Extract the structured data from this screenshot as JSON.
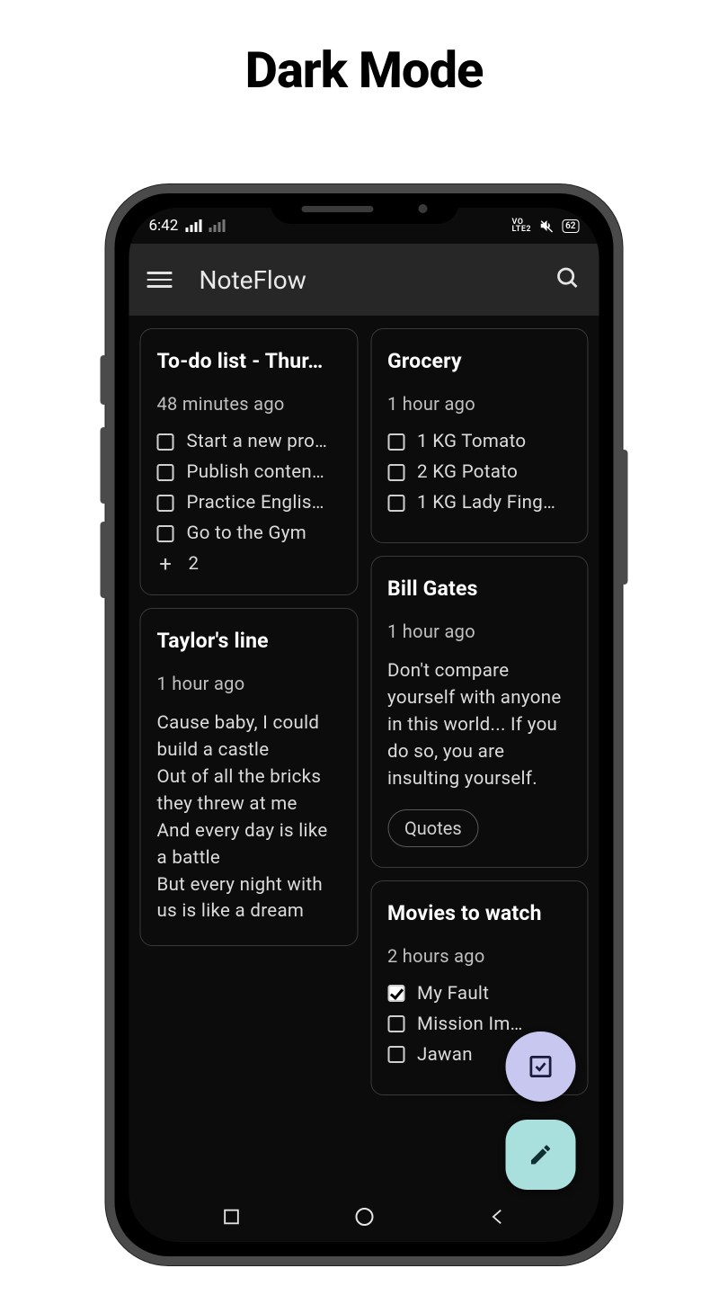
{
  "page_title": "Dark Mode",
  "statusbar": {
    "time": "6:42",
    "lte": "VO\nLTE2",
    "battery": "62"
  },
  "appbar": {
    "title": "NoteFlow"
  },
  "left_col": [
    {
      "type": "checklist",
      "title": "To-do list - Thur…",
      "time": "48 minutes ago",
      "items": [
        {
          "checked": false,
          "label": "Start a new pro…"
        },
        {
          "checked": false,
          "label": "Publish conten…"
        },
        {
          "checked": false,
          "label": "Practice Englis…"
        },
        {
          "checked": false,
          "label": "Go to the Gym"
        }
      ],
      "more": "2"
    },
    {
      "type": "text",
      "title": "Taylor's line",
      "time": "1 hour ago",
      "body": "Cause baby, I could build a castle\nOut of all the bricks they threw at me\nAnd every day is like a battle\nBut every night with us is like a dream"
    }
  ],
  "right_col": [
    {
      "type": "checklist",
      "title": "Grocery",
      "time": "1 hour ago",
      "items": [
        {
          "checked": false,
          "label": "1 KG Tomato"
        },
        {
          "checked": false,
          "label": "2 KG Potato"
        },
        {
          "checked": false,
          "label": "1 KG Lady Fing…"
        }
      ]
    },
    {
      "type": "text",
      "title": "Bill Gates",
      "time": "1 hour ago",
      "body": "Don't compare yourself with anyone in this world... If you do so, you are insulting yourself.",
      "tag": "Quotes"
    },
    {
      "type": "checklist",
      "title": "Movies to watch",
      "time": "2 hours ago",
      "items": [
        {
          "checked": true,
          "label": "My Fault"
        },
        {
          "checked": false,
          "label": "Mission Im…"
        },
        {
          "checked": false,
          "label": "Jawan"
        }
      ]
    }
  ]
}
